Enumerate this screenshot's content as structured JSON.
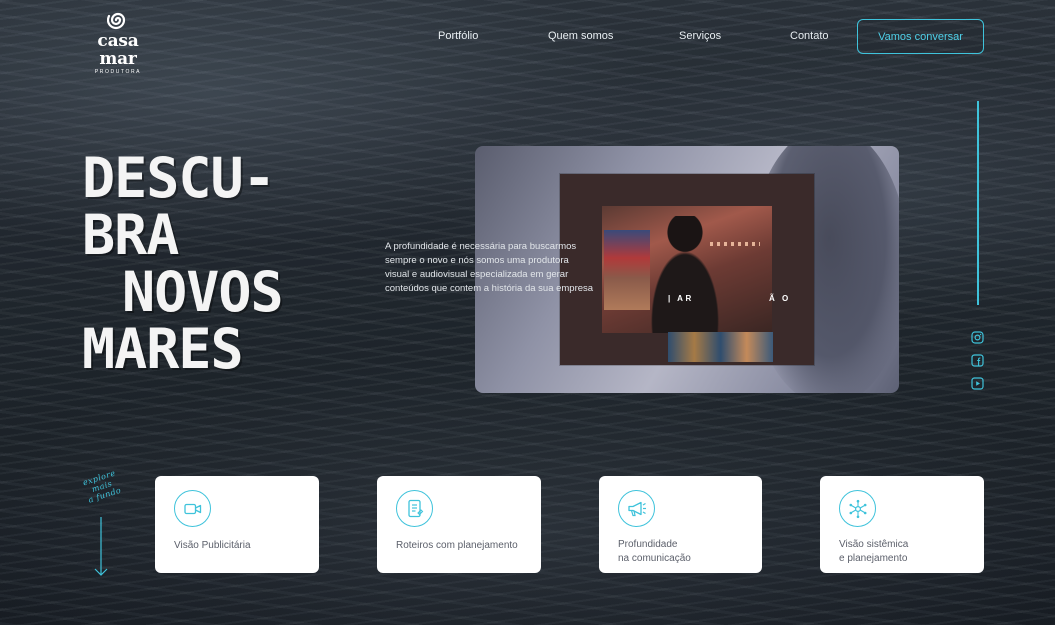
{
  "header": {
    "logo": {
      "name": "casa mar",
      "subtitle": "PRODUTORA",
      "icon": "spiral-icon"
    },
    "nav": [
      "Portfólio",
      "Quem somos",
      "Serviços",
      "Contato"
    ],
    "cta_label": "Vamos conversar"
  },
  "hero": {
    "title_lines": [
      "DESCU-",
      "BRA",
      "NOVOS",
      "MARES"
    ],
    "description": "A profundidade é necessária para buscarmos sempre o novo e nós somos uma produtora visual e audiovisual especializada em gerar conteúdos que contem a história da sua empresa",
    "video_caption_left": "| AR",
    "video_caption_right": "Ã O"
  },
  "social": [
    {
      "name": "instagram-icon"
    },
    {
      "name": "facebook-icon"
    },
    {
      "name": "youtube-icon"
    }
  ],
  "explore": {
    "lines": [
      "explore",
      "mais",
      "a fundo"
    ]
  },
  "services": [
    {
      "icon": "video-camera-icon",
      "label_lines": [
        "Visão Publicitária"
      ]
    },
    {
      "icon": "script-document-icon",
      "label_lines": [
        "Roteiros com planejamento"
      ]
    },
    {
      "icon": "megaphone-icon",
      "label_lines": [
        "Profundidade",
        "na comunicação"
      ]
    },
    {
      "icon": "network-icon",
      "label_lines": [
        "Visão sistêmica",
        "e planejamento"
      ]
    }
  ],
  "colors": {
    "accent": "#3fc3db",
    "background": "#252c33",
    "card": "#ffffff"
  }
}
